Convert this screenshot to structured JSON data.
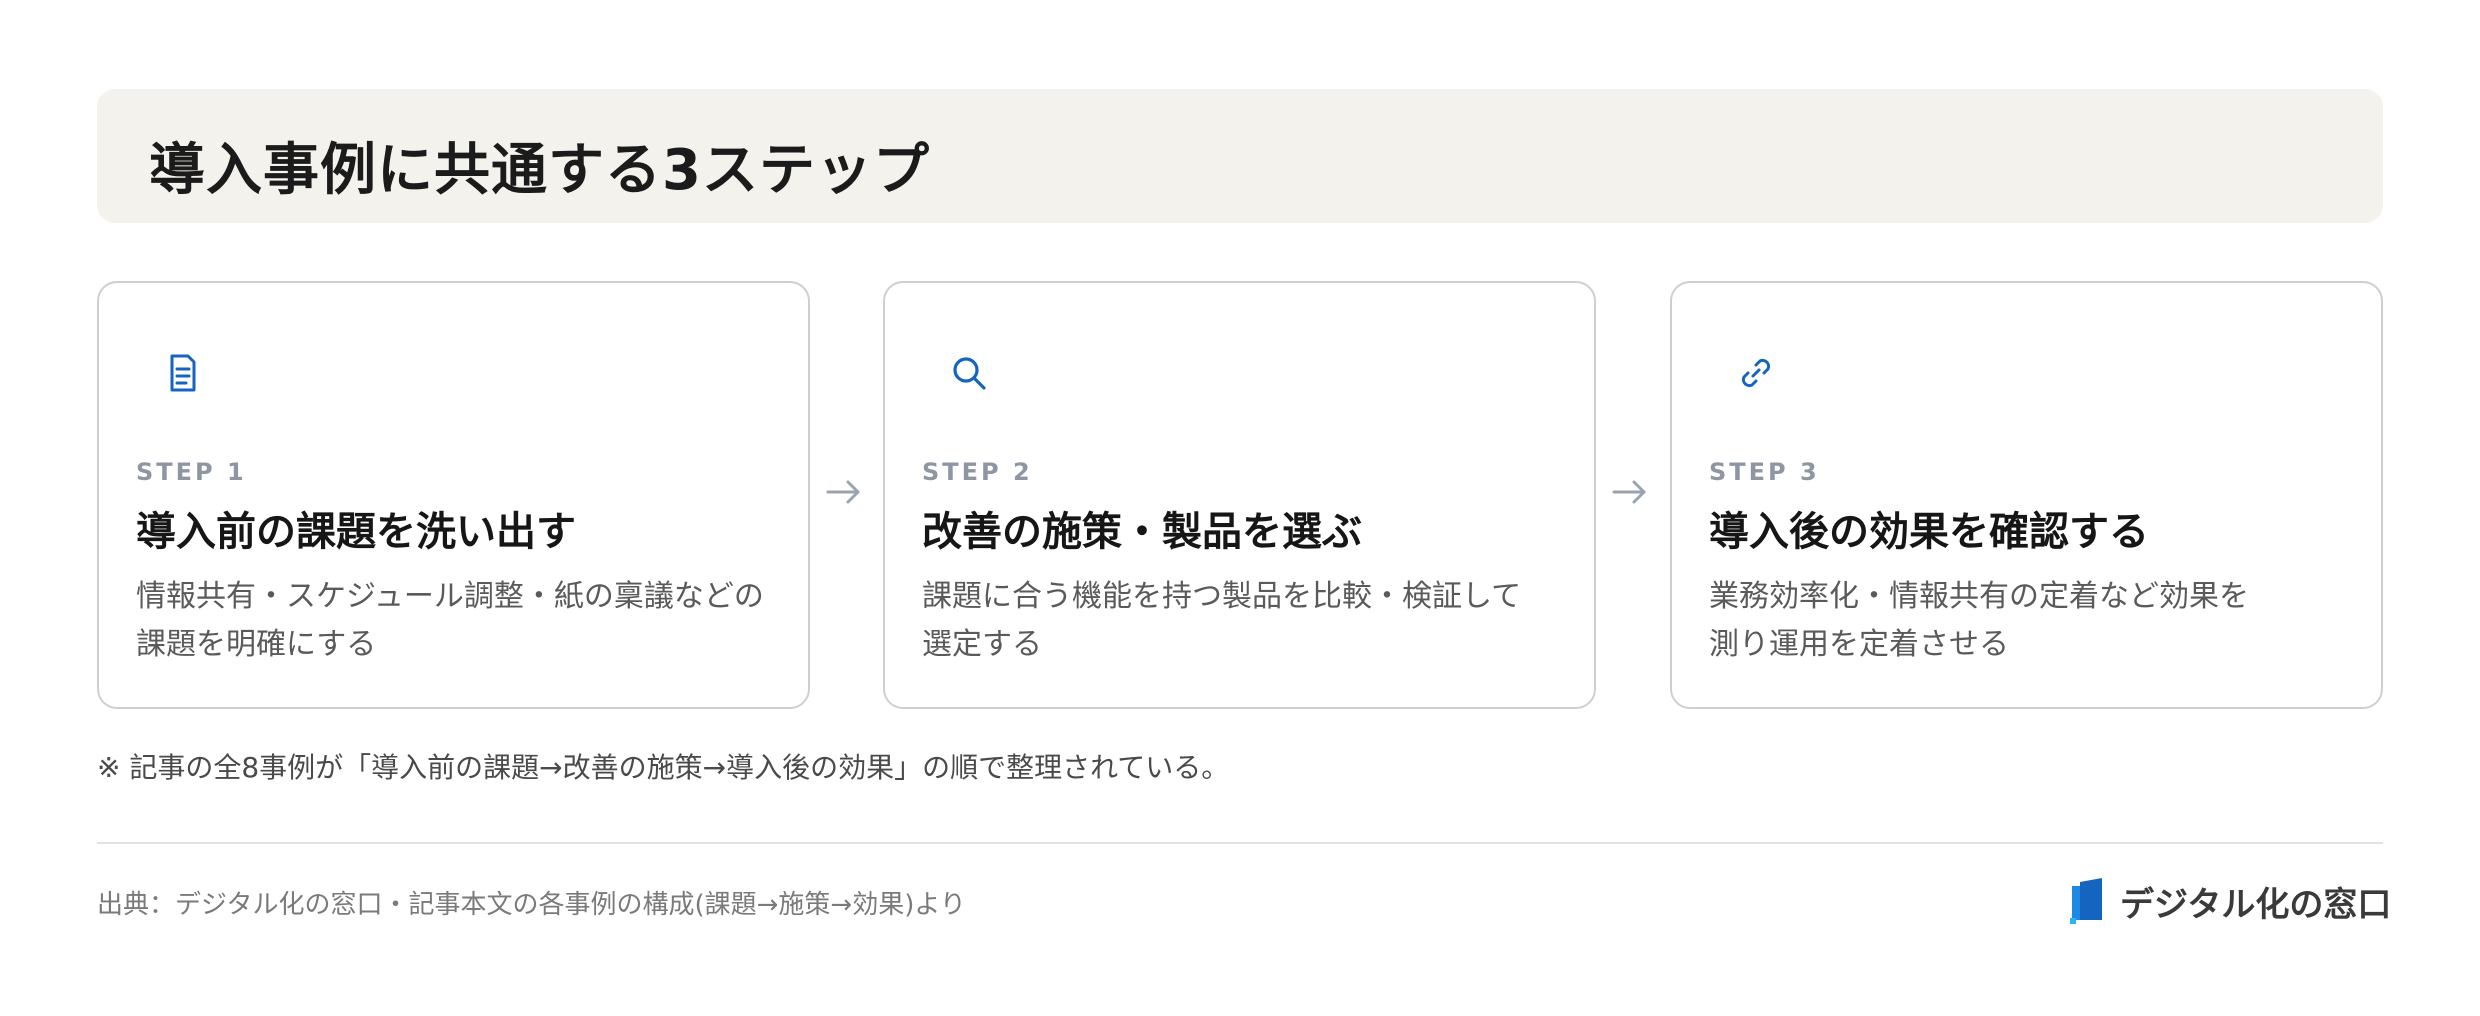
{
  "header": {
    "title": "導入事例に共通する3ステップ"
  },
  "colors": {
    "header_bg": "#f4f2ec",
    "icon_accent": "#1565c0",
    "step_label": "#8f96a3",
    "arrow": "#9aa3b0"
  },
  "steps": [
    {
      "icon": "document-icon",
      "label": "STEP 1",
      "title": "導入前の課題を洗い出す",
      "desc_lines": [
        "情報共有・スケジュール調整・紙の稟議などの",
        "課題を明確にする"
      ]
    },
    {
      "icon": "search-icon",
      "label": "STEP 2",
      "title": "改善の施策・製品を選ぶ",
      "desc_lines": [
        "課題に合う機能を持つ製品を比較・検証して",
        "選定する"
      ]
    },
    {
      "icon": "link-icon",
      "label": "STEP 3",
      "title": "導入後の効果を確認する",
      "desc_lines": [
        "業務効率化・情報共有の定着など効果を",
        "測り運用を定着させる"
      ]
    }
  ],
  "note": "※ 記事の全8事例が「導入前の課題→改善の施策→導入後の効果」の順で整理されている。",
  "footer": {
    "source": "出典：デジタル化の窓口・記事本文の各事例の構成(課題→施策→効果)より",
    "brand_name": "デジタル化の窓口",
    "brand_icon": "brand-logo-icon"
  }
}
